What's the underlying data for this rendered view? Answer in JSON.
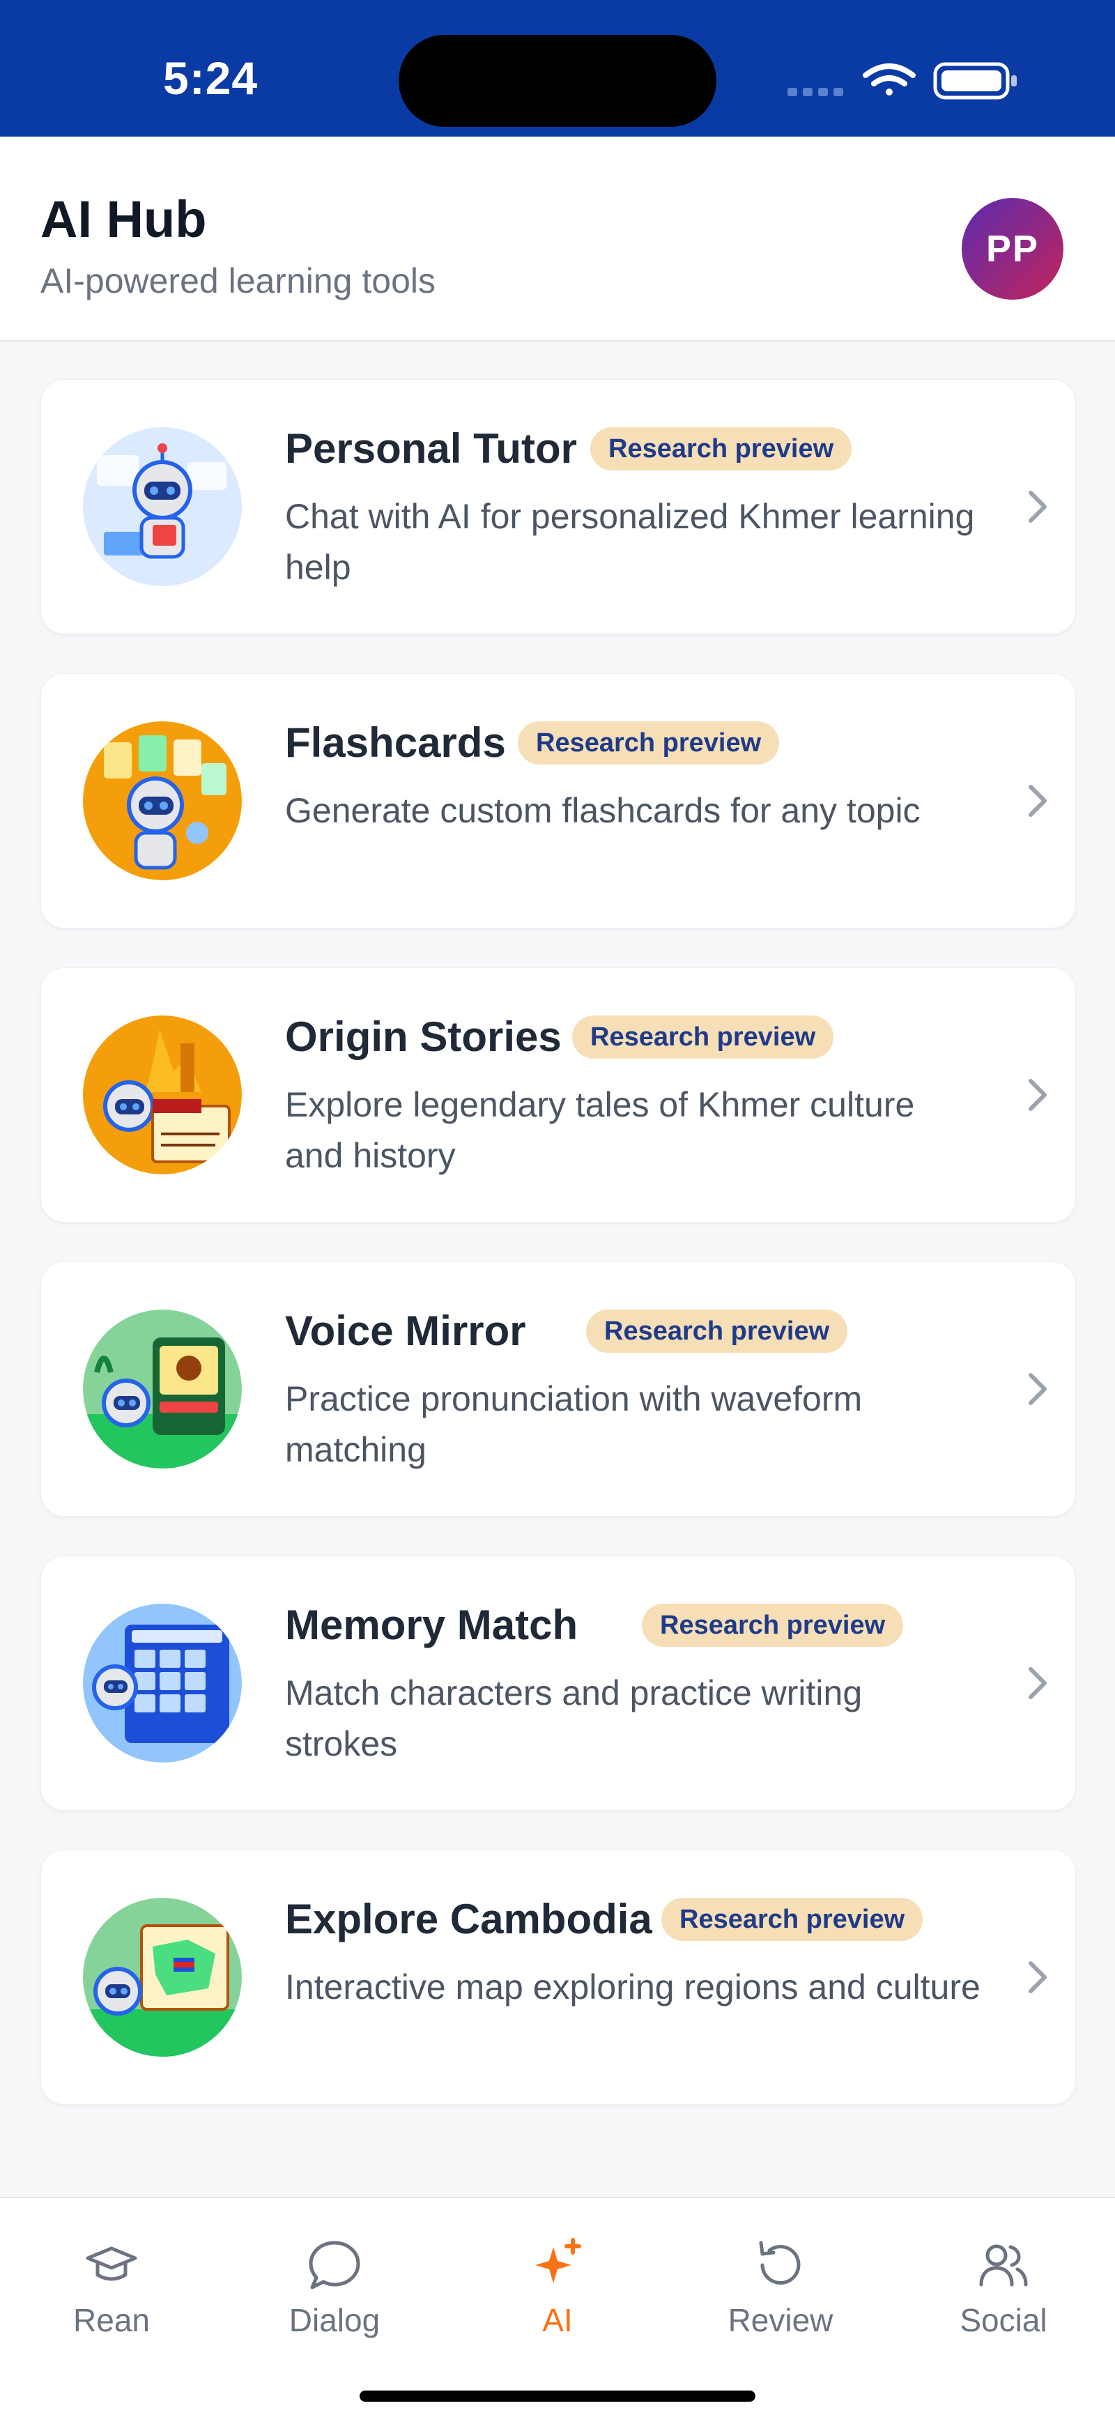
{
  "status_bar": {
    "time": "5:24"
  },
  "header": {
    "title": "AI Hub",
    "subtitle": "AI-powered learning tools",
    "avatar_initials": "PP"
  },
  "tools": [
    {
      "title": "Personal Tutor",
      "badge": "Research preview",
      "description": "Chat with AI for personalized Khmer learning help",
      "thumb_bg": "#dbeafe"
    },
    {
      "title": "Flashcards",
      "badge": "Research preview",
      "description": "Generate custom flashcards for any topic",
      "thumb_bg": "#f59e0b"
    },
    {
      "title": "Origin Stories",
      "badge": "Research preview",
      "description": "Explore legendary tales of Khmer culture and history",
      "thumb_bg": "#f59e0b"
    },
    {
      "title": "Voice Mirror",
      "badge": "Research preview",
      "description": "Practice pronunciation with waveform matching",
      "thumb_bg": "#86d39a"
    },
    {
      "title": "Memory Match",
      "badge": "Research preview",
      "description": "Match characters and practice writing strokes",
      "thumb_bg": "#93c5fd"
    },
    {
      "title": "Explore Cambodia",
      "badge": "Research preview",
      "description": "Interactive map exploring regions and culture",
      "thumb_bg": "#86d39a"
    }
  ],
  "tab_bar": {
    "tabs": [
      {
        "label": "Rean",
        "icon": "graduation-cap-icon"
      },
      {
        "label": "Dialog",
        "icon": "chat-bubble-icon"
      },
      {
        "label": "AI",
        "icon": "sparkle-icon",
        "active": true
      },
      {
        "label": "Review",
        "icon": "refresh-icon"
      },
      {
        "label": "Social",
        "icon": "users-icon"
      }
    ]
  },
  "colors": {
    "status_bar": "#0a3aa3",
    "accent": "#f97316",
    "badge_bg": "#f6dfb6",
    "badge_text": "#1e3a8a"
  }
}
